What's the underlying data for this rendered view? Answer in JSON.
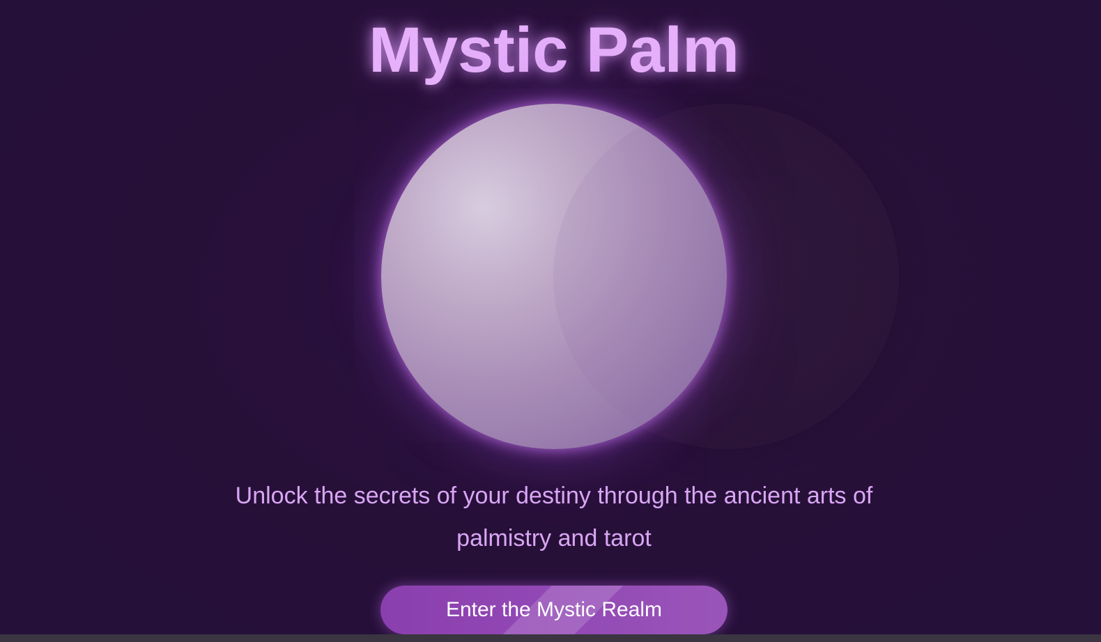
{
  "header": {
    "title": "Mystic Palm"
  },
  "hero": {
    "orb_color": "#c4b0cc",
    "glow_color": "#be6ee6"
  },
  "main": {
    "tagline": "Unlock the secrets of your destiny through the ancient arts of palmistry and tarot",
    "cta_label": "Enter the Mystic Realm"
  },
  "theme": {
    "background": "#281039",
    "title_color": "#e6b0fb",
    "tagline_color": "#d9a6f4",
    "button_color": "#9248b5"
  }
}
